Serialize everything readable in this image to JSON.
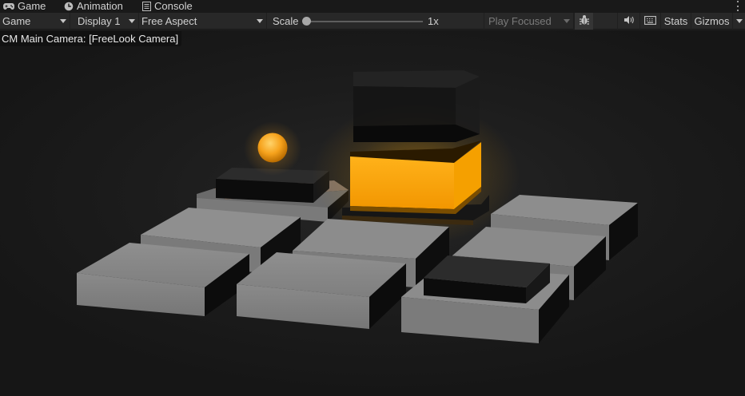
{
  "tabs": [
    {
      "label": "Game",
      "icon": "gamepad-icon"
    },
    {
      "label": "Animation",
      "icon": "clock-icon"
    },
    {
      "label": "Console",
      "icon": "console-icon"
    }
  ],
  "toolbar": {
    "view_mode": "Game",
    "display": "Display 1",
    "aspect": "Free Aspect",
    "scale_label": "Scale",
    "scale_value": "1x",
    "play_mode": "Play Focused",
    "stats_label": "Stats",
    "gizmos_label": "Gizmos"
  },
  "viewport": {
    "camera_label": "CM Main Camera: [FreeLook Camera]"
  },
  "colors": {
    "accent_glow": "#f5a300",
    "sphere": "#f6a21c",
    "tile_light": "#8a8a8a",
    "tile_dark": "#202020"
  }
}
